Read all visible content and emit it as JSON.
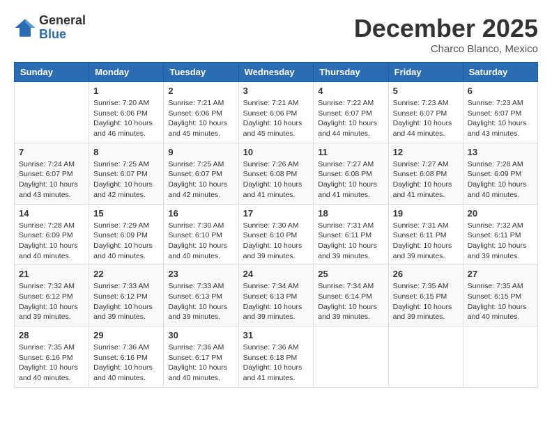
{
  "logo": {
    "general": "General",
    "blue": "Blue"
  },
  "header": {
    "month": "December 2025",
    "location": "Charco Blanco, Mexico"
  },
  "weekdays": [
    "Sunday",
    "Monday",
    "Tuesday",
    "Wednesday",
    "Thursday",
    "Friday",
    "Saturday"
  ],
  "weeks": [
    [
      {
        "day": "",
        "info": ""
      },
      {
        "day": "1",
        "info": "Sunrise: 7:20 AM\nSunset: 6:06 PM\nDaylight: 10 hours\nand 46 minutes."
      },
      {
        "day": "2",
        "info": "Sunrise: 7:21 AM\nSunset: 6:06 PM\nDaylight: 10 hours\nand 45 minutes."
      },
      {
        "day": "3",
        "info": "Sunrise: 7:21 AM\nSunset: 6:06 PM\nDaylight: 10 hours\nand 45 minutes."
      },
      {
        "day": "4",
        "info": "Sunrise: 7:22 AM\nSunset: 6:07 PM\nDaylight: 10 hours\nand 44 minutes."
      },
      {
        "day": "5",
        "info": "Sunrise: 7:23 AM\nSunset: 6:07 PM\nDaylight: 10 hours\nand 44 minutes."
      },
      {
        "day": "6",
        "info": "Sunrise: 7:23 AM\nSunset: 6:07 PM\nDaylight: 10 hours\nand 43 minutes."
      }
    ],
    [
      {
        "day": "7",
        "info": "Sunrise: 7:24 AM\nSunset: 6:07 PM\nDaylight: 10 hours\nand 43 minutes."
      },
      {
        "day": "8",
        "info": "Sunrise: 7:25 AM\nSunset: 6:07 PM\nDaylight: 10 hours\nand 42 minutes."
      },
      {
        "day": "9",
        "info": "Sunrise: 7:25 AM\nSunset: 6:07 PM\nDaylight: 10 hours\nand 42 minutes."
      },
      {
        "day": "10",
        "info": "Sunrise: 7:26 AM\nSunset: 6:08 PM\nDaylight: 10 hours\nand 41 minutes."
      },
      {
        "day": "11",
        "info": "Sunrise: 7:27 AM\nSunset: 6:08 PM\nDaylight: 10 hours\nand 41 minutes."
      },
      {
        "day": "12",
        "info": "Sunrise: 7:27 AM\nSunset: 6:08 PM\nDaylight: 10 hours\nand 41 minutes."
      },
      {
        "day": "13",
        "info": "Sunrise: 7:28 AM\nSunset: 6:09 PM\nDaylight: 10 hours\nand 40 minutes."
      }
    ],
    [
      {
        "day": "14",
        "info": "Sunrise: 7:28 AM\nSunset: 6:09 PM\nDaylight: 10 hours\nand 40 minutes."
      },
      {
        "day": "15",
        "info": "Sunrise: 7:29 AM\nSunset: 6:09 PM\nDaylight: 10 hours\nand 40 minutes."
      },
      {
        "day": "16",
        "info": "Sunrise: 7:30 AM\nSunset: 6:10 PM\nDaylight: 10 hours\nand 40 minutes."
      },
      {
        "day": "17",
        "info": "Sunrise: 7:30 AM\nSunset: 6:10 PM\nDaylight: 10 hours\nand 39 minutes."
      },
      {
        "day": "18",
        "info": "Sunrise: 7:31 AM\nSunset: 6:11 PM\nDaylight: 10 hours\nand 39 minutes."
      },
      {
        "day": "19",
        "info": "Sunrise: 7:31 AM\nSunset: 6:11 PM\nDaylight: 10 hours\nand 39 minutes."
      },
      {
        "day": "20",
        "info": "Sunrise: 7:32 AM\nSunset: 6:11 PM\nDaylight: 10 hours\nand 39 minutes."
      }
    ],
    [
      {
        "day": "21",
        "info": "Sunrise: 7:32 AM\nSunset: 6:12 PM\nDaylight: 10 hours\nand 39 minutes."
      },
      {
        "day": "22",
        "info": "Sunrise: 7:33 AM\nSunset: 6:12 PM\nDaylight: 10 hours\nand 39 minutes."
      },
      {
        "day": "23",
        "info": "Sunrise: 7:33 AM\nSunset: 6:13 PM\nDaylight: 10 hours\nand 39 minutes."
      },
      {
        "day": "24",
        "info": "Sunrise: 7:34 AM\nSunset: 6:13 PM\nDaylight: 10 hours\nand 39 minutes."
      },
      {
        "day": "25",
        "info": "Sunrise: 7:34 AM\nSunset: 6:14 PM\nDaylight: 10 hours\nand 39 minutes."
      },
      {
        "day": "26",
        "info": "Sunrise: 7:35 AM\nSunset: 6:15 PM\nDaylight: 10 hours\nand 39 minutes."
      },
      {
        "day": "27",
        "info": "Sunrise: 7:35 AM\nSunset: 6:15 PM\nDaylight: 10 hours\nand 40 minutes."
      }
    ],
    [
      {
        "day": "28",
        "info": "Sunrise: 7:35 AM\nSunset: 6:16 PM\nDaylight: 10 hours\nand 40 minutes."
      },
      {
        "day": "29",
        "info": "Sunrise: 7:36 AM\nSunset: 6:16 PM\nDaylight: 10 hours\nand 40 minutes."
      },
      {
        "day": "30",
        "info": "Sunrise: 7:36 AM\nSunset: 6:17 PM\nDaylight: 10 hours\nand 40 minutes."
      },
      {
        "day": "31",
        "info": "Sunrise: 7:36 AM\nSunset: 6:18 PM\nDaylight: 10 hours\nand 41 minutes."
      },
      {
        "day": "",
        "info": ""
      },
      {
        "day": "",
        "info": ""
      },
      {
        "day": "",
        "info": ""
      }
    ]
  ]
}
